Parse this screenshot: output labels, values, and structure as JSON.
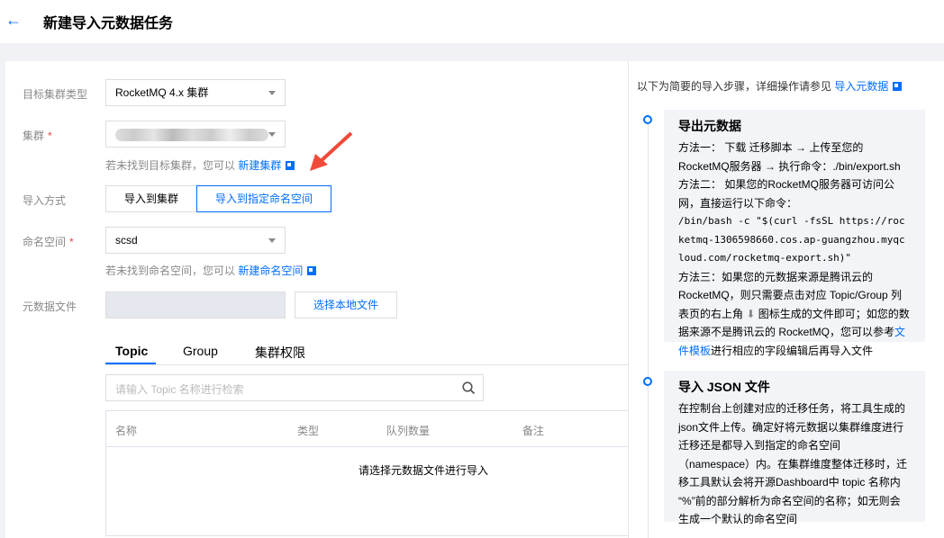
{
  "header": {
    "back_icon": "arrow-left-icon",
    "title": "新建导入元数据任务"
  },
  "form": {
    "cluster_type": {
      "label": "目标集群类型",
      "value": "RocketMQ 4.x 集群"
    },
    "cluster": {
      "label": "集群",
      "required_mark": "*",
      "hint": "若未找到目标集群，您可以",
      "link": "新建集群"
    },
    "import_mode": {
      "label": "导入方式",
      "options": [
        "导入到集群",
        "导入到指定命名空间"
      ],
      "selected": 1
    },
    "namespace": {
      "label": "命名空间",
      "required_mark": "*",
      "value": "scsd",
      "hint": "若未找到命名空间，您可以",
      "link": "新建命名空间"
    },
    "file": {
      "label": "元数据文件",
      "button": "选择本地文件"
    }
  },
  "tabs": [
    "Topic",
    "Group",
    "集群权限"
  ],
  "search": {
    "placeholder": "请输入 Topic 名称进行检索"
  },
  "table": {
    "columns": [
      "名称",
      "类型",
      "队列数量",
      "备注"
    ],
    "empty": "请选择元数据文件进行导入"
  },
  "guide": {
    "intro": "以下为简要的导入步骤，详细操作请参见",
    "intro_link": "导入元数据",
    "step1": {
      "title": "导出元数据",
      "l1": "方法一： 下载 迁移脚本 → 上传至您的 RocketMQ服务器 → 执行命令：./bin/export.sh",
      "l2": "方法二： 如果您的RocketMQ服务器可访问公网，直接运行以下命令：",
      "cmd": "/bin/bash -c \"$(curl -fsSL https://rocketmq-1306598660.cos.ap-guangzhou.myqcloud.com/rocketmq-export.sh)\"",
      "l3a": "方法三：如果您的元数据来源是腾讯云的 RocketMQ，则只需要点击对应 Topic/Group 列表页的右上角",
      "l3b": "图标生成的文件即可；如您的数据来源不是腾讯云的 RocketMQ，您可以参考",
      "l3link": "文件模板",
      "l3c": "进行相应的字段编辑后再导入文件"
    },
    "step2": {
      "title": "导入 JSON 文件",
      "text": "在控制台上创建对应的迁移任务，将工具生成的json文件上传。确定好将元数据以集群维度进行迁移还是都导入到指定的命名空间（namespace）内。在集群维度整体迁移时，迁移工具默认会将开源Dashboard中 topic 名称内 “%”前的部分解析为命名空间的名称；如无则会生成一个默认的命名空间"
    }
  },
  "colors": {
    "accent": "#006eff",
    "annotation_arrow": "#f04a3a"
  }
}
